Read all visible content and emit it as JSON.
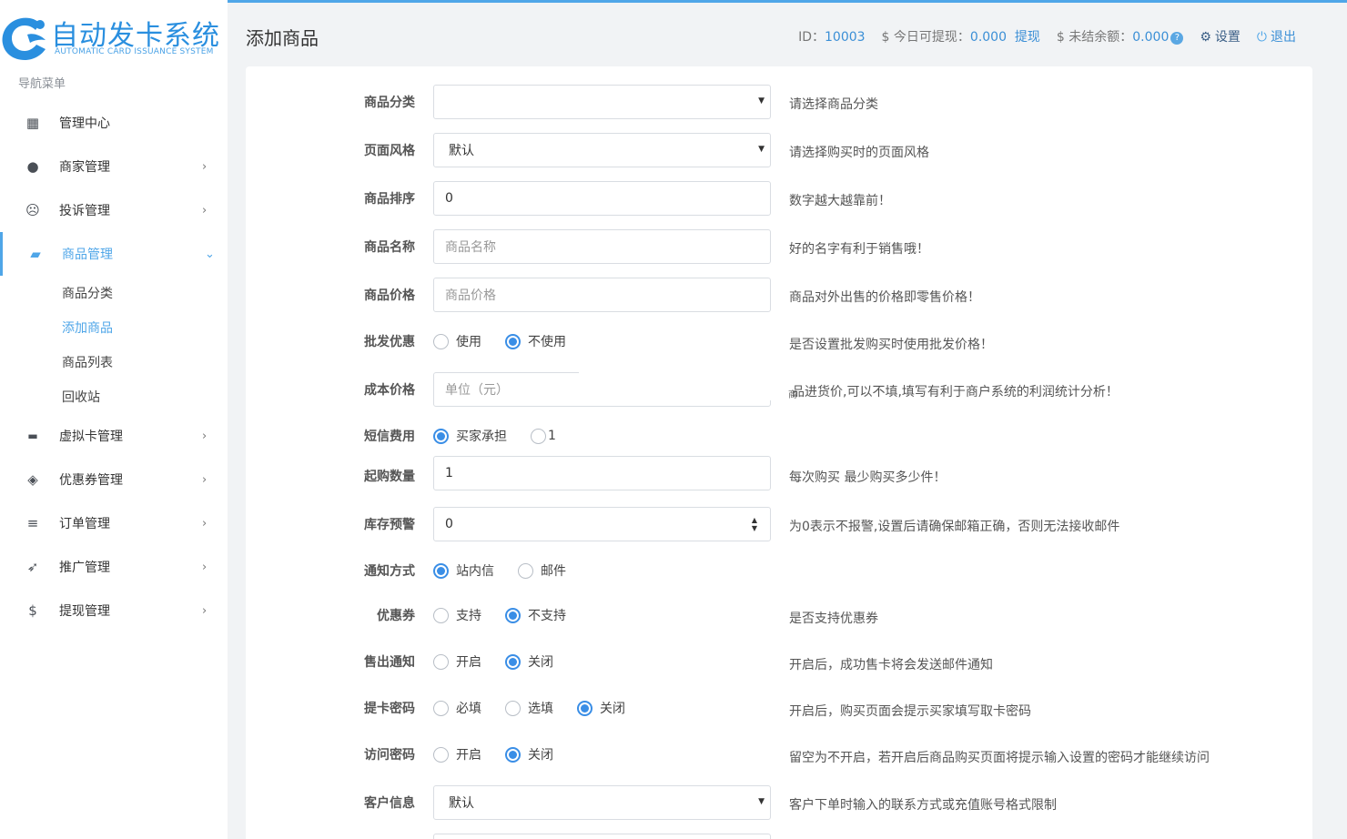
{
  "brand": {
    "title": "自动发卡系统",
    "subtitle": "AUTOMATIC CARD ISSUANCE SYSTEM",
    "color": "#2a8fdf"
  },
  "sidebar": {
    "caption": "导航菜单",
    "items": [
      {
        "label": "管理中心",
        "icon": "dashboard-icon"
      },
      {
        "label": "商家管理",
        "icon": "user-icon"
      },
      {
        "label": "投诉管理",
        "icon": "frown-icon"
      },
      {
        "label": "商品管理",
        "icon": "shopping-bag-icon"
      },
      {
        "label": "虚拟卡管理",
        "icon": "credit-card-icon"
      },
      {
        "label": "优惠券管理",
        "icon": "tag-icon"
      },
      {
        "label": "订单管理",
        "icon": "list-icon"
      },
      {
        "label": "推广管理",
        "icon": "paper-plane-icon"
      },
      {
        "label": "提现管理",
        "icon": "dollar-icon"
      }
    ],
    "sub_items": [
      "商品分类",
      "添加商品",
      "商品列表",
      "回收站"
    ]
  },
  "header": {
    "page_title": "添加商品",
    "id_label": "ID：",
    "id_value": "10003",
    "withdrawable_label": "$ 今日可提现：",
    "withdrawable_value": "0.000",
    "withdraw_link": "提现",
    "unsettled_label": "$ 未结余额：",
    "unsettled_value": "0.000",
    "help_badge": "?",
    "settings": "设置",
    "logout": "退出"
  },
  "form": {
    "category": {
      "label": "商品分类",
      "value": "",
      "help": "请选择商品分类"
    },
    "style": {
      "label": "页面风格",
      "value": "默认",
      "help": "请选择购买时的页面风格"
    },
    "sort": {
      "label": "商品排序",
      "value": "0",
      "help": "数字越大越靠前！"
    },
    "name": {
      "label": "商品名称",
      "placeholder": "商品名称",
      "help": "好的名字有利于销售哦！"
    },
    "price": {
      "label": "商品价格",
      "placeholder": "商品价格",
      "help": "商品对外出售的价格即零售价格！"
    },
    "wholesale": {
      "label": "批发优惠",
      "options": [
        "使用",
        "不使用"
      ],
      "selected": 1,
      "help": "是否设置批发购买时使用批发价格！"
    },
    "cost": {
      "label": "成本价格",
      "placeholder": "单位（元）",
      "help": "品进货价,可以不填,填写有利于商户系统的利润统计分析！",
      "help_glyph": "商"
    },
    "sms": {
      "label": "短信费用",
      "options": [
        "买家承担",
        "1"
      ],
      "selected": 0
    },
    "min_qty": {
      "label": "起购数量",
      "value": "1",
      "help": "每次购买 最少购买多少件！"
    },
    "stock_alert": {
      "label": "库存预警",
      "value": "0",
      "help": "为0表示不报警,设置后请确保邮箱正确，否则无法接收邮件"
    },
    "notify": {
      "label": "通知方式",
      "options": [
        "站内信",
        "邮件"
      ],
      "selected": 0
    },
    "coupon": {
      "label": "优惠券",
      "options": [
        "支持",
        "不支持"
      ],
      "selected": 1,
      "help": "是否支持优惠券"
    },
    "sold_notify": {
      "label": "售出通知",
      "options": [
        "开启",
        "关闭"
      ],
      "selected": 1,
      "help": "开启后，成功售卡将会发送邮件通知"
    },
    "card_pwd": {
      "label": "提卡密码",
      "options": [
        "必填",
        "选填",
        "关闭"
      ],
      "selected": 2,
      "help": "开启后，购买页面会提示买家填写取卡密码"
    },
    "visit_pwd": {
      "label": "访问密码",
      "options": [
        "开启",
        "关闭"
      ],
      "selected": 1,
      "help": "留空为不开启，若开启后商品购买页面将提示输入设置的密码才能继续访问"
    },
    "customer": {
      "label": "客户信息",
      "value": "默认",
      "help": "客户下单时输入的联系方式或充值账号格式限制"
    }
  }
}
